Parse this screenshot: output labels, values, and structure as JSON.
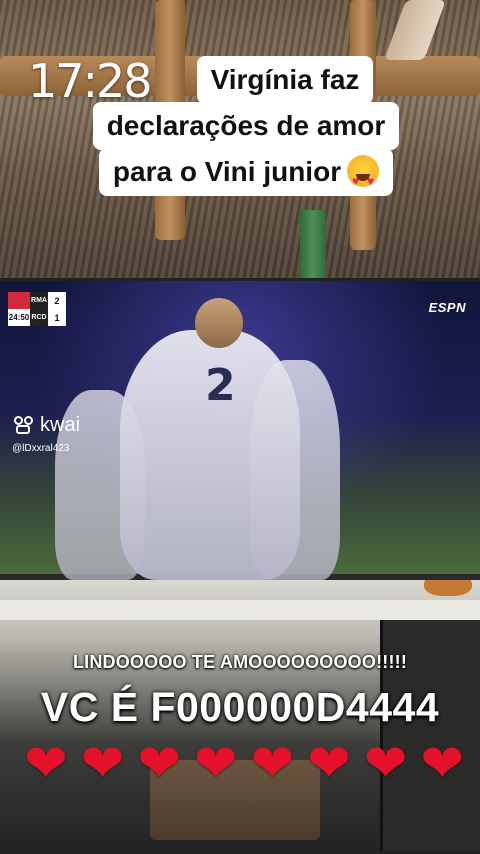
{
  "status_bar": {
    "time": "17:28"
  },
  "caption": {
    "line1": "Virgínia faz",
    "line2": "declarações de amor",
    "line3": "para o Vini junior",
    "emoji": "heart-eyes"
  },
  "tv_broadcast": {
    "scorebug": {
      "team1": "RMA",
      "team2": "RCD",
      "score1": "2",
      "score2": "1",
      "clock": "24:50"
    },
    "channel_logo": "ESPN",
    "jersey_number": "2"
  },
  "watermark": {
    "app": "kwai",
    "username": "@lDxxral423"
  },
  "comments": {
    "line1": "LINDOOOOO TE AMOOOOOOOOO!!!!!",
    "line2": "VC É F000000D4444",
    "hearts": [
      "❤",
      "❤",
      "❤",
      "❤",
      "❤",
      "❤",
      "❤",
      "❤"
    ]
  },
  "colors": {
    "heart": "#e5112a",
    "caption_bg": "#ffffff"
  }
}
